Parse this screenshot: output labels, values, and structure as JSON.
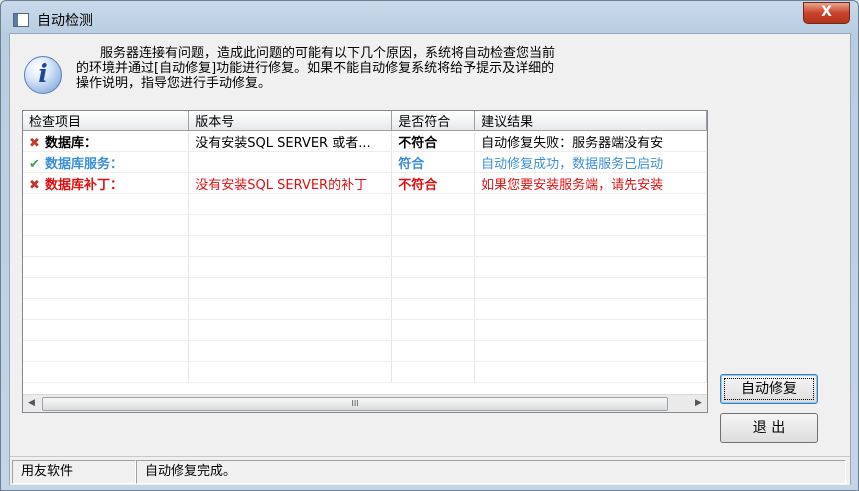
{
  "window": {
    "title": "自动检测",
    "close_label": "X"
  },
  "info": {
    "icon": "info-icon",
    "lines": [
      "服务器连接有问题，造成此问题的可能有以下几个原因，系统将自动检查您当前",
      "的环境并通过[自动修复]功能进行修复。如果不能自动修复系统将给予提示及详细的",
      "操作说明，指导您进行手动修复。"
    ]
  },
  "grid": {
    "columns": [
      "检查项目",
      "版本号",
      "是否符合",
      "建议结果"
    ],
    "rows": [
      {
        "icon": "x-mark-icon",
        "mark": "✖",
        "name": "数据库：",
        "version": "没有安装SQL SERVER 或者...",
        "match": "不符合",
        "result": "自动修复失败：服务器端没有安",
        "color": "#000000",
        "mark_color": "#c0392b"
      },
      {
        "icon": "check-mark-icon",
        "mark": "✔",
        "name": "数据库服务：",
        "version": "",
        "match": "符合",
        "result": "自动修复成功，数据服务已启动",
        "color": "#3a8fd8",
        "mark_color": "#3aa84a"
      },
      {
        "icon": "x-mark-icon",
        "mark": "✖",
        "name": "数据库补丁：",
        "version": "没有安装SQL SERVER的补丁",
        "match": "不符合",
        "result": "如果您要安装服务端，请先安装",
        "color": "#e01010",
        "mark_color": "#c0392b"
      }
    ],
    "scroll_grip": "III"
  },
  "buttons": {
    "auto_repair": "自动修复",
    "exit": "退 出"
  },
  "statusbar": {
    "left": "用友软件",
    "right": "自动修复完成。"
  }
}
